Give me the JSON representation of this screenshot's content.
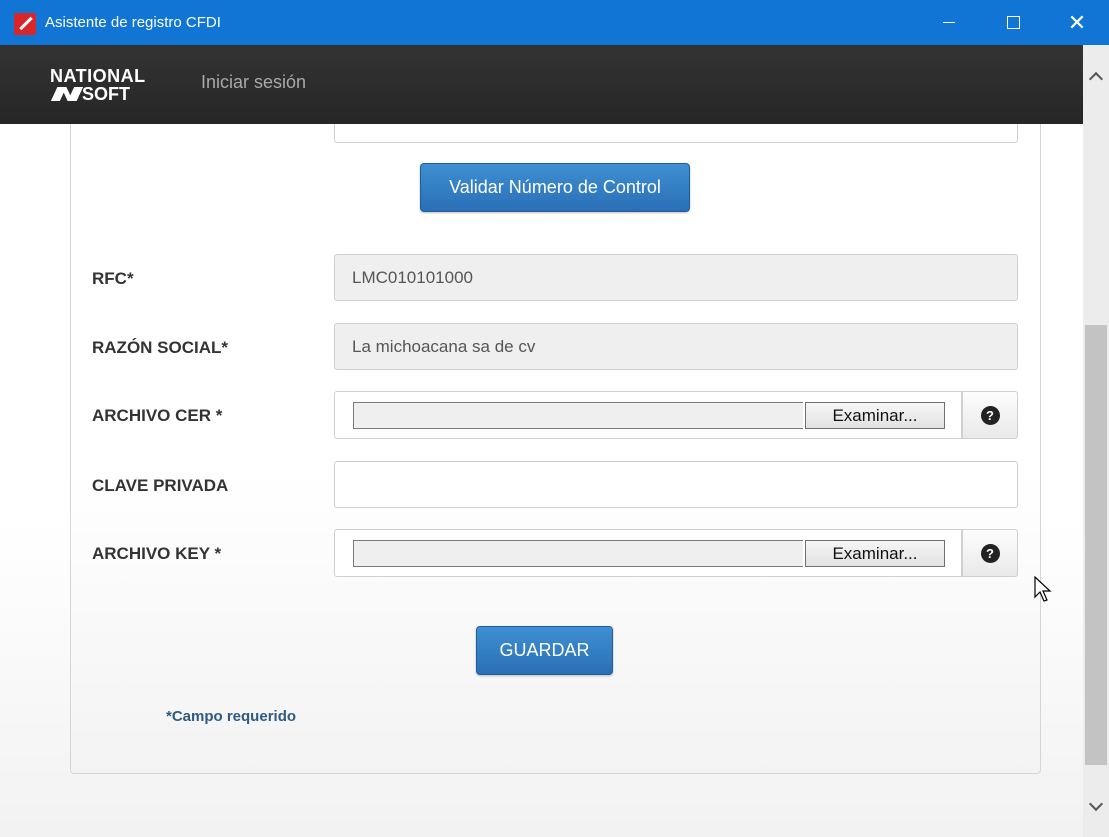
{
  "window": {
    "title": "Asistente de registro CFDI",
    "controls": {
      "minimize": "minimize-icon",
      "maximize": "maximize-icon",
      "close": "close-icon"
    }
  },
  "header": {
    "logo_line1": "NATIONAL",
    "logo_line2": "SOFT",
    "nav_link": "Iniciar sesión"
  },
  "form": {
    "validate_button": "Validar Número de Control",
    "fields": {
      "rfc": {
        "label": "RFC*",
        "value": "LMC010101000"
      },
      "razon_social": {
        "label": "RAZÓN SOCIAL*",
        "value": "La michoacana sa de cv"
      },
      "archivo_cer": {
        "label": "ARCHIVO CER *",
        "browse": "Examinar..."
      },
      "clave_privada": {
        "label": "CLAVE PRIVADA",
        "value": ""
      },
      "archivo_key": {
        "label": "ARCHIVO KEY *",
        "browse": "Examinar..."
      }
    },
    "save_button": "GUARDAR",
    "required_note": "*Campo requerido"
  },
  "colors": {
    "titlebar": "#1175d6",
    "navbar": "#2b2b2b",
    "button_blue": "#2f7bc4"
  }
}
